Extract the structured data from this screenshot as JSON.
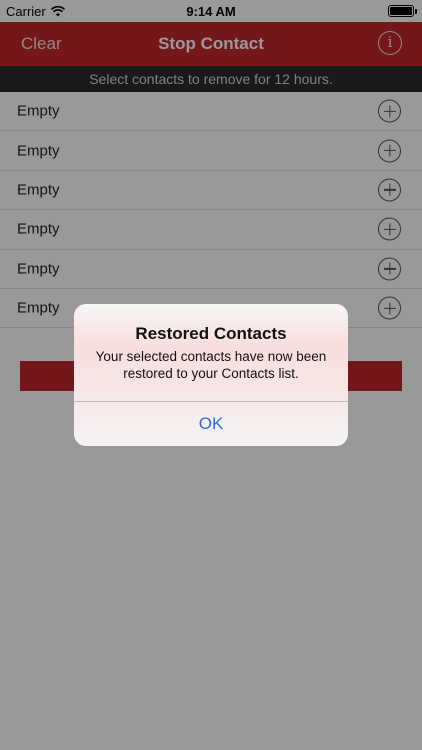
{
  "status_bar": {
    "carrier": "Carrier",
    "time": "9:14 AM",
    "battery_level": 1.0,
    "icons": [
      "wifi-icon",
      "battery-icon"
    ]
  },
  "nav": {
    "left_label": "Clear",
    "title": "Stop Contact",
    "right_icon": "info-icon",
    "right_glyph": "i",
    "color": "#c0272d"
  },
  "banner": {
    "text": "Select contacts to remove for 12 hours."
  },
  "contacts": [
    {
      "label": "Empty"
    },
    {
      "label": "Empty"
    },
    {
      "label": "Empty"
    },
    {
      "label": "Empty"
    },
    {
      "label": "Empty"
    },
    {
      "label": "Empty"
    }
  ],
  "alert": {
    "title": "Restored Contacts",
    "message": "Your selected contacts have now been restored to your Contacts list.",
    "ok_label": "OK",
    "button_color": "#2a6fd6"
  }
}
